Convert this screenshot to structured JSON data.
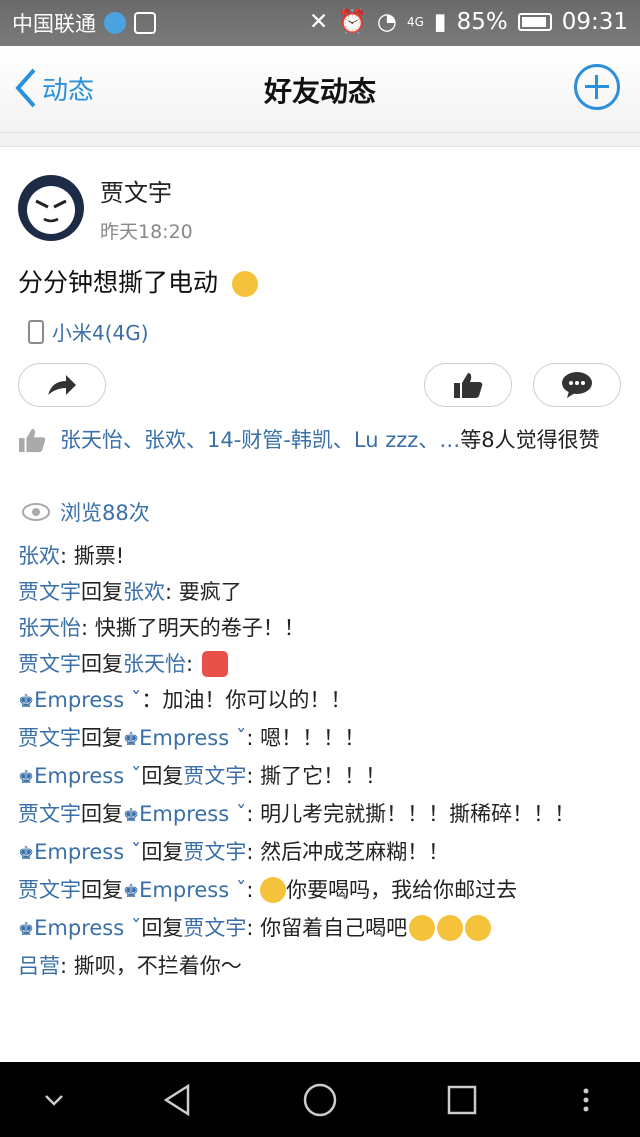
{
  "status": {
    "carrier": "中国联通",
    "network": "4G",
    "battery": "85%",
    "time": "09:31"
  },
  "header": {
    "back_label": "动态",
    "title": "好友动态"
  },
  "post": {
    "author": "贾文宇",
    "time": "昨天18:20",
    "content": "分分钟想撕了电动",
    "device": "小米4(4G)",
    "likes": {
      "names": "张天怡、张欢、14-财管-韩凯、Lu zzz、…",
      "suffix": "等8人觉得很赞"
    },
    "views": "浏览88次"
  },
  "comments": [
    {
      "from": "张欢",
      "to": "",
      "text": "撕票!"
    },
    {
      "from": "贾文宇",
      "to": "张欢",
      "text": "要疯了"
    },
    {
      "from": "张天怡",
      "to": "",
      "text": "快撕了明天的卷子！！"
    },
    {
      "from": "贾文宇",
      "to": "张天怡",
      "text": ""
    },
    {
      "from": "Empress ˇ",
      "to": "",
      "text": "加油！你可以的！！"
    },
    {
      "from": "贾文宇",
      "to": "Empress ˇ",
      "text": "嗯！！！！"
    },
    {
      "from": "Empress ˇ",
      "to": "贾文宇",
      "text": "撕了它！！！"
    },
    {
      "from": "贾文宇",
      "to": "Empress ˇ",
      "text": "明儿考完就撕！！！撕稀碎！！！"
    },
    {
      "from": "Empress ˇ",
      "to": "贾文宇",
      "text": "然后冲成芝麻糊！！"
    },
    {
      "from": "贾文宇",
      "to": "Empress ˇ",
      "text": "你要喝吗，我给你邮过去"
    },
    {
      "from": "Empress ˇ",
      "to": "贾文宇",
      "text": "你留着自己喝吧"
    },
    {
      "from": "吕营",
      "to": "",
      "text": "撕呗，不拦着你～"
    }
  ],
  "reply_word": "回复",
  "colors": {
    "accent": "#2b90d9",
    "name": "#3a6fa8"
  }
}
